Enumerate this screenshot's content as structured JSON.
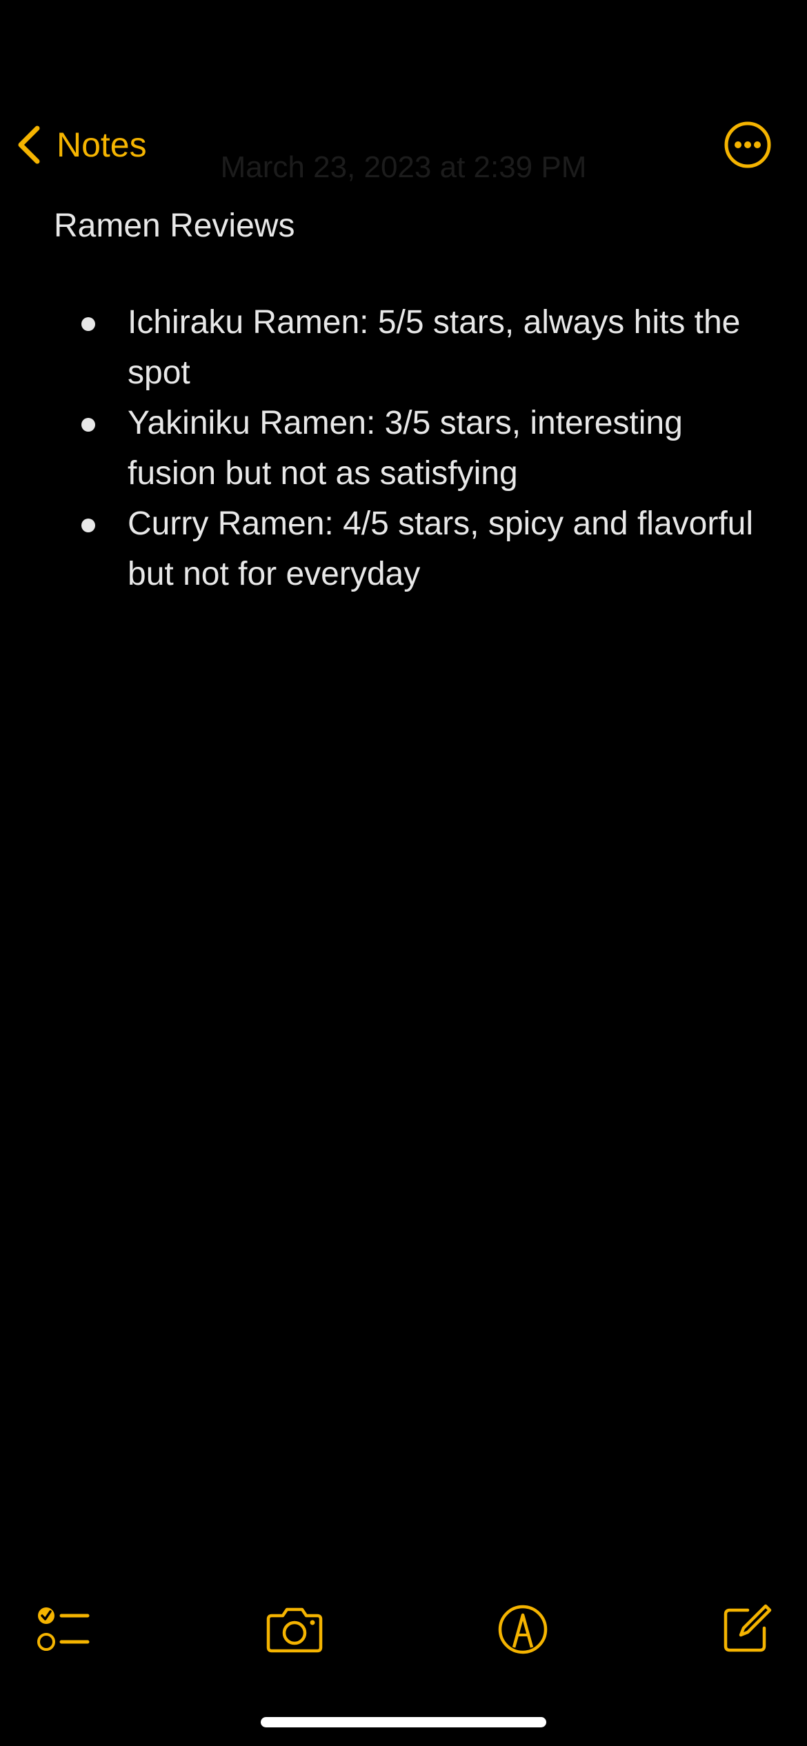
{
  "theme": {
    "accent": "#F5B400",
    "background": "#000000",
    "text": "#E8E8E8"
  },
  "nav": {
    "back_label": "Notes",
    "back_icon": "chevron-left-icon",
    "more_icon": "ellipsis-circle-icon"
  },
  "note": {
    "date": "March 23, 2023 at 2:39 PM",
    "title": "Ramen Reviews",
    "items": [
      "Ichiraku Ramen: 5/5 stars, always hits the spot",
      "Yakiniku Ramen: 3/5 stars, interesting fusion but not as satisfying",
      "Curry Ramen: 4/5 stars, spicy and flavorful but not for everyday"
    ]
  },
  "toolbar": {
    "checklist_icon": "checklist-icon",
    "camera_icon": "camera-icon",
    "markup_icon": "markup-pen-icon",
    "compose_icon": "compose-icon"
  }
}
